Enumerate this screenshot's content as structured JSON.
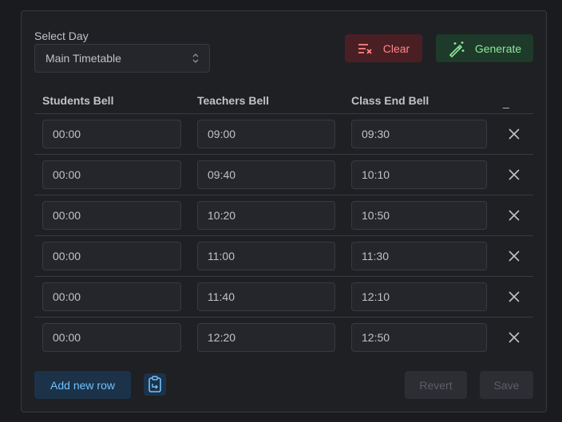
{
  "day_select": {
    "label": "Select Day",
    "value": "Main Timetable"
  },
  "actions": {
    "clear": "Clear",
    "generate": "Generate"
  },
  "table": {
    "headers": [
      "Students Bell",
      "Teachers Bell",
      "Class End Bell"
    ],
    "actions_header": "_",
    "rows": [
      {
        "students": "00:00",
        "teachers": "09:00",
        "end": "09:30"
      },
      {
        "students": "00:00",
        "teachers": "09:40",
        "end": "10:10"
      },
      {
        "students": "00:00",
        "teachers": "10:20",
        "end": "10:50"
      },
      {
        "students": "00:00",
        "teachers": "11:00",
        "end": "11:30"
      },
      {
        "students": "00:00",
        "teachers": "11:40",
        "end": "12:10"
      },
      {
        "students": "00:00",
        "teachers": "12:20",
        "end": "12:50"
      }
    ]
  },
  "footer": {
    "add_row": "Add new row",
    "revert": "Revert",
    "save": "Save"
  },
  "colors": {
    "danger": "#ff8787",
    "success": "#8ce99a",
    "primary": "#74c0fc"
  },
  "icons": {
    "clear": "clear-all-icon",
    "generate": "wand-icon",
    "remove": "close-icon",
    "clipboard": "clipboard-icon",
    "select": "selector-icon"
  }
}
